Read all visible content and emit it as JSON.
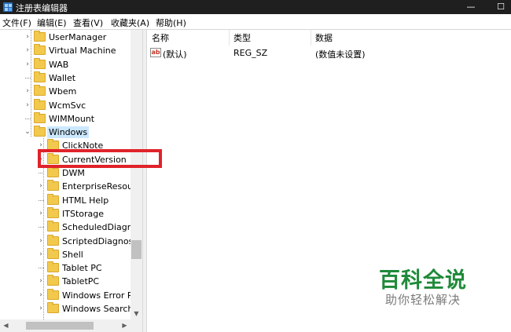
{
  "window": {
    "title": "注册表编辑器",
    "minimize_glyph": "—",
    "maximize_glyph": "☐"
  },
  "menu": [
    "文件(F)",
    "编辑(E)",
    "查看(V)",
    "收藏夹(A)",
    "帮助(H)"
  ],
  "tree": {
    "items": [
      {
        "label": "UserManager",
        "level": 1,
        "expandable": true
      },
      {
        "label": "Virtual Machine",
        "level": 1,
        "expandable": true
      },
      {
        "label": "WAB",
        "level": 1,
        "expandable": true
      },
      {
        "label": "Wallet",
        "level": 1,
        "expandable": false
      },
      {
        "label": "Wbem",
        "level": 1,
        "expandable": true
      },
      {
        "label": "WcmSvc",
        "level": 1,
        "expandable": true
      },
      {
        "label": "WIMMount",
        "level": 1,
        "expandable": false
      },
      {
        "label": "Windows",
        "level": 1,
        "expandable": true,
        "expanded": true,
        "selected": true
      },
      {
        "label": "ClickNote",
        "level": 2,
        "expandable": true
      },
      {
        "label": "CurrentVersion",
        "level": 2,
        "expandable": true
      },
      {
        "label": "DWM",
        "level": 2,
        "expandable": false
      },
      {
        "label": "EnterpriseResour",
        "level": 2,
        "expandable": true
      },
      {
        "label": "HTML Help",
        "level": 2,
        "expandable": false
      },
      {
        "label": "ITStorage",
        "level": 2,
        "expandable": true
      },
      {
        "label": "ScheduledDiagno",
        "level": 2,
        "expandable": false
      },
      {
        "label": "ScriptedDiagnost",
        "level": 2,
        "expandable": true
      },
      {
        "label": "Shell",
        "level": 2,
        "expandable": true
      },
      {
        "label": "Tablet PC",
        "level": 2,
        "expandable": false
      },
      {
        "label": "TabletPC",
        "level": 2,
        "expandable": true
      },
      {
        "label": "Windows Error Re",
        "level": 2,
        "expandable": true
      },
      {
        "label": "Windows Search",
        "level": 2,
        "expandable": true
      }
    ]
  },
  "list": {
    "columns": [
      "名称",
      "类型",
      "数据"
    ],
    "rows": [
      {
        "name": "(默认)",
        "type": "REG_SZ",
        "data": "(数值未设置)",
        "icon": "string-value-icon"
      }
    ]
  },
  "watermark": {
    "title": "百科全说",
    "subtitle": "助你轻松解决"
  },
  "colors": {
    "highlight": "#e0232a",
    "selection": "#cce8ff",
    "folder": "#f2c94c",
    "watermark_green": "#1f8a3a"
  }
}
